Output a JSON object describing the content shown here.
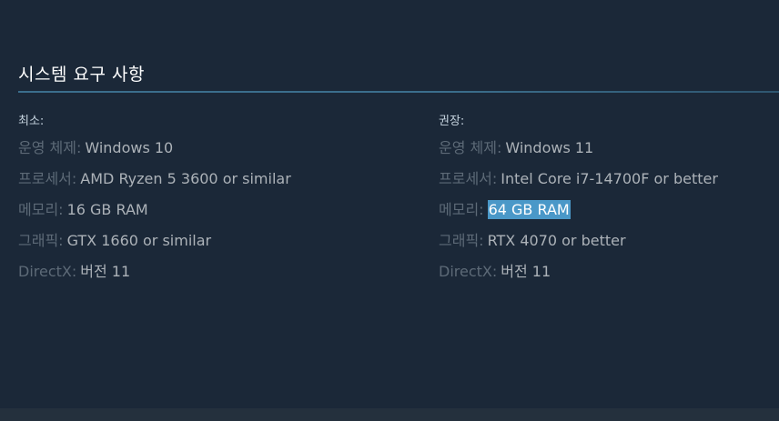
{
  "section": {
    "title": "시스템 요구 사항"
  },
  "minimum": {
    "header": "최소:",
    "rows": [
      {
        "label": "운영 체제:",
        "value": "Windows 10"
      },
      {
        "label": "프로세서:",
        "value": "AMD Ryzen 5 3600 or similar"
      },
      {
        "label": "메모리:",
        "value": "16 GB RAM"
      },
      {
        "label": "그래픽:",
        "value": "GTX 1660 or similar"
      },
      {
        "label": "DirectX:",
        "value": "버전 11"
      }
    ]
  },
  "recommended": {
    "header": "권장:",
    "rows": [
      {
        "label": "운영 체제:",
        "value": "Windows 11"
      },
      {
        "label": "프로세서:",
        "value": "Intel Core i7-14700F or better"
      },
      {
        "label": "메모리:",
        "value": "64 GB RAM",
        "selected": true
      },
      {
        "label": "그래픽:",
        "value": "RTX 4070 or better"
      },
      {
        "label": "DirectX:",
        "value": "버전 11"
      }
    ]
  },
  "colors": {
    "background": "#1b2838",
    "selection_highlight": "#4a98c8",
    "label": "#5d6a77",
    "value": "#acb2b8"
  }
}
